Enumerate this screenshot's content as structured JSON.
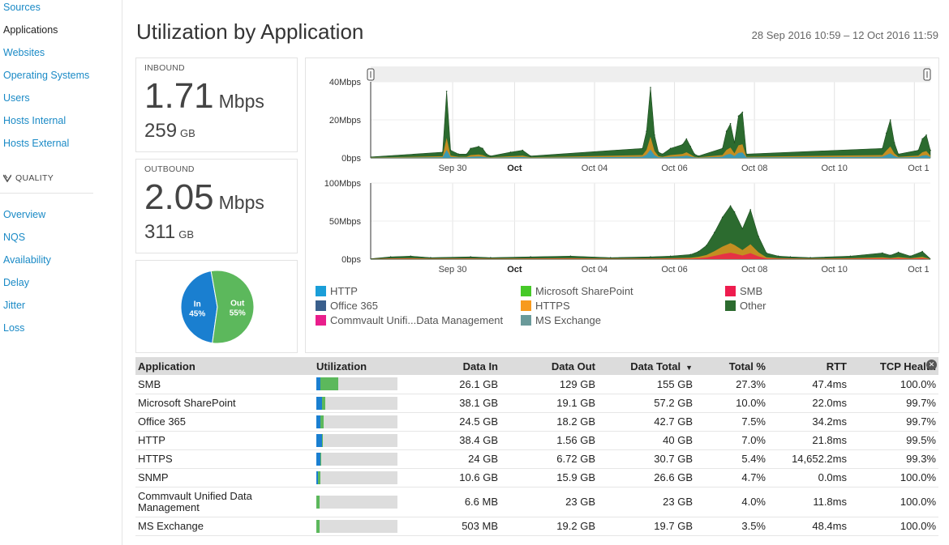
{
  "sidebar": {
    "items": [
      {
        "label": "Sources",
        "active": false
      },
      {
        "label": "Applications",
        "active": true
      },
      {
        "label": "Websites",
        "active": false
      },
      {
        "label": "Operating Systems",
        "active": false
      },
      {
        "label": "Users",
        "active": false
      },
      {
        "label": "Hosts Internal",
        "active": false
      },
      {
        "label": "Hosts External",
        "active": false
      }
    ],
    "section_label": "QUALITY",
    "quality_items": [
      {
        "label": "Overview"
      },
      {
        "label": "NQS"
      },
      {
        "label": "Availability"
      },
      {
        "label": "Delay"
      },
      {
        "label": "Jitter"
      },
      {
        "label": "Loss"
      }
    ]
  },
  "header": {
    "title": "Utilization by Application",
    "date_range": "28 Sep 2016 10:59 – 12 Oct 2016 11:59"
  },
  "inbound": {
    "label": "INBOUND",
    "rate": "1.71",
    "rate_unit": "Mbps",
    "volume": "259",
    "volume_unit": "GB"
  },
  "outbound": {
    "label": "OUTBOUND",
    "rate": "2.05",
    "rate_unit": "Mbps",
    "volume": "311",
    "volume_unit": "GB"
  },
  "pie": {
    "slices": [
      {
        "label": "In",
        "value": 45,
        "display": "45%",
        "color": "#1a7fd0"
      },
      {
        "label": "Out",
        "value": 55,
        "display": "55%",
        "color": "#5cb85c"
      }
    ]
  },
  "chart_data": [
    {
      "type": "area",
      "series_stack": "Other",
      "ylabels": [
        "40Mbps",
        "20Mbps",
        "0bps"
      ],
      "ylim": [
        0,
        40
      ],
      "x_ticks": [
        "Sep 30",
        "Oct",
        "Oct 04",
        "Oct 06",
        "Oct 08",
        "Oct 10",
        "Oct 1"
      ],
      "x_ticks_bold": [
        "Oct"
      ],
      "x_range_days": [
        0,
        14
      ],
      "x": [
        1.8,
        1.9,
        2.0,
        2.2,
        2.4,
        2.5,
        2.7,
        2.8,
        2.9,
        3.0,
        3.5,
        3.8,
        4.0,
        6.8,
        6.9,
        7.0,
        7.1,
        7.2,
        7.3,
        7.5,
        7.8,
        7.9,
        8.0,
        8.1,
        8.2,
        8.8,
        8.9,
        9.0,
        9.1,
        9.2,
        9.3,
        9.4,
        12.8,
        12.9,
        13.0,
        13.1,
        13.2,
        13.7,
        13.8,
        13.9,
        14.0
      ],
      "values": [
        3,
        35,
        4,
        2,
        2,
        5,
        6,
        5,
        2,
        1,
        3,
        4,
        1,
        5,
        14,
        37,
        12,
        3,
        2,
        5,
        7,
        10,
        6,
        2,
        1,
        5,
        14,
        18,
        8,
        22,
        24,
        2,
        5,
        13,
        20,
        8,
        2,
        4,
        10,
        12,
        4
      ]
    },
    {
      "type": "area",
      "ylabels": [
        "100Mbps",
        "50Mbps",
        "0bps"
      ],
      "ylim": [
        0,
        100
      ],
      "x_ticks": [
        "Sep 30",
        "Oct",
        "Oct 04",
        "Oct 06",
        "Oct 08",
        "Oct 10",
        "Oct 1"
      ],
      "x_ticks_bold": [
        "Oct"
      ],
      "x_range_days": [
        0,
        14
      ],
      "x": [
        0.5,
        1.0,
        1.5,
        2.5,
        3.0,
        4.0,
        5.0,
        6.0,
        7.0,
        7.5,
        8.0,
        8.2,
        8.4,
        8.6,
        8.8,
        9.0,
        9.1,
        9.3,
        9.5,
        9.7,
        9.9,
        10.2,
        10.5,
        11.0,
        12.0,
        12.8,
        13.0,
        13.2,
        13.5,
        13.8
      ],
      "values": [
        3,
        4,
        2,
        3,
        2,
        3,
        4,
        2,
        3,
        4,
        6,
        10,
        18,
        35,
        55,
        70,
        62,
        40,
        65,
        30,
        8,
        4,
        3,
        2,
        4,
        8,
        5,
        9,
        4,
        10
      ]
    }
  ],
  "legend": [
    {
      "label": "HTTP",
      "color": "#1a9ed8"
    },
    {
      "label": "Microsoft SharePoint",
      "color": "#46c928"
    },
    {
      "label": "SMB",
      "color": "#ee1c4e"
    },
    {
      "label": "Office 365",
      "color": "#3a5f8c"
    },
    {
      "label": "HTTPS",
      "color": "#f79a1e"
    },
    {
      "label": "Other",
      "color": "#2c6b2f"
    },
    {
      "label": "Commvault Unifi...Data Management",
      "color": "#e91e8c"
    },
    {
      "label": "MS Exchange",
      "color": "#6a9a9a"
    }
  ],
  "table": {
    "headers": [
      "Application",
      "Utilization",
      "Data In",
      "Data Out",
      "Data Total",
      "Total %",
      "RTT",
      "TCP Health"
    ],
    "rows": [
      {
        "app": "SMB",
        "in_frac": 0.05,
        "out_frac": 0.22,
        "data_in": "26.1 GB",
        "data_out": "129 GB",
        "data_total": "155 GB",
        "total_pct": "27.3%",
        "rtt": "47.4ms",
        "tcp": "100.0%"
      },
      {
        "app": "Microsoft SharePoint",
        "in_frac": 0.07,
        "out_frac": 0.04,
        "data_in": "38.1 GB",
        "data_out": "19.1 GB",
        "data_total": "57.2 GB",
        "total_pct": "10.0%",
        "rtt": "22.0ms",
        "tcp": "99.7%"
      },
      {
        "app": "Office 365",
        "in_frac": 0.05,
        "out_frac": 0.04,
        "data_in": "24.5 GB",
        "data_out": "18.2 GB",
        "data_total": "42.7 GB",
        "total_pct": "7.5%",
        "rtt": "34.2ms",
        "tcp": "99.7%"
      },
      {
        "app": "HTTP",
        "in_frac": 0.07,
        "out_frac": 0.005,
        "data_in": "38.4 GB",
        "data_out": "1.56 GB",
        "data_total": "40 GB",
        "total_pct": "7.0%",
        "rtt": "21.8ms",
        "tcp": "99.5%"
      },
      {
        "app": "HTTPS",
        "in_frac": 0.045,
        "out_frac": 0.015,
        "data_in": "24 GB",
        "data_out": "6.72 GB",
        "data_total": "30.7 GB",
        "total_pct": "5.4%",
        "rtt": "14,652.2ms",
        "tcp": "99.3%"
      },
      {
        "app": "SNMP",
        "in_frac": 0.02,
        "out_frac": 0.03,
        "data_in": "10.6 GB",
        "data_out": "15.9 GB",
        "data_total": "26.6 GB",
        "total_pct": "4.7%",
        "rtt": "0.0ms",
        "tcp": "100.0%"
      },
      {
        "app": "Commvault Unified Data Management",
        "in_frac": 0.0,
        "out_frac": 0.04,
        "data_in": "6.6 MB",
        "data_out": "23 GB",
        "data_total": "23 GB",
        "total_pct": "4.0%",
        "rtt": "11.8ms",
        "tcp": "100.0%",
        "tall": true
      },
      {
        "app": "MS Exchange",
        "in_frac": 0.002,
        "out_frac": 0.035,
        "data_in": "503 MB",
        "data_out": "19.2 GB",
        "data_total": "19.7 GB",
        "total_pct": "3.5%",
        "rtt": "48.4ms",
        "tcp": "100.0%"
      }
    ]
  }
}
